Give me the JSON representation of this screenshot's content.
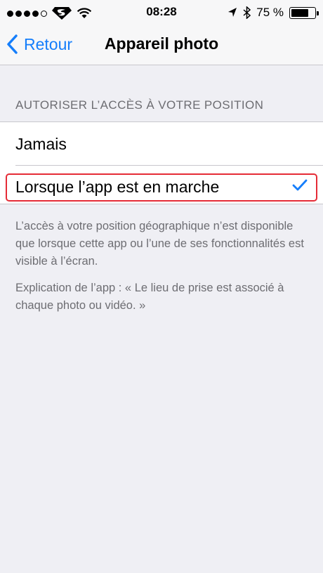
{
  "status_bar": {
    "time": "08:28",
    "battery_percent": "75 %",
    "battery_level": 0.75,
    "signal_bars_filled": 4,
    "signal_bars_total": 5,
    "carrier_icon": "superman-logo-icon",
    "wifi_icon": "wifi-icon",
    "location_icon": "location-arrow-icon",
    "bluetooth_icon": "bluetooth-icon"
  },
  "nav": {
    "back_label": "Retour",
    "title": "Appareil photo"
  },
  "section": {
    "header": "AUTORISER L’ACCÈS À VOTRE POSITION",
    "options": [
      {
        "label": "Jamais",
        "selected": false
      },
      {
        "label": "Lorsque l’app est en marche",
        "selected": true
      }
    ]
  },
  "footer": {
    "note": "L’accès à votre position géographique n’est disponible que lorsque cette app ou l’une de ses fonctionnalités est visible à l’écran.",
    "explanation": "Explication de l’app : « Le lieu de prise est associé à chaque photo ou vidéo. »"
  },
  "colors": {
    "accent": "#157efb",
    "highlight": "#e52b36",
    "background": "#efeff4"
  }
}
